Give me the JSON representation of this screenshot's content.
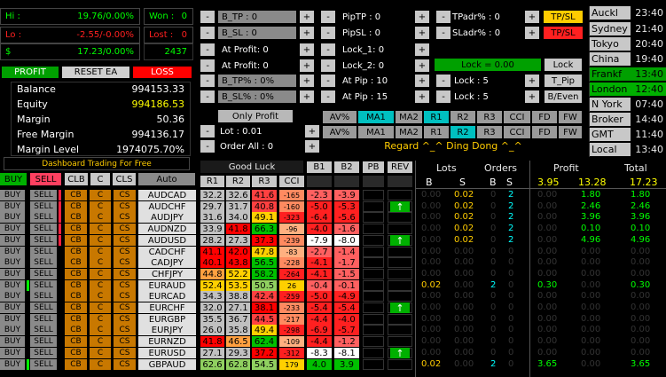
{
  "stats": {
    "hi_label": "Hi :",
    "hi_value": "19.76/0.00%",
    "lo_label": "Lo :",
    "lo_value": "-2.55/-0.00%",
    "usd_label": "$",
    "usd_value": "17.23/0.00%",
    "won_label": "Won :",
    "won_value": "0",
    "lost_label": "Lost :",
    "lost_value": "0",
    "count_value": "2437"
  },
  "controls": {
    "profit": "PROFIT",
    "reset": "RESET EA",
    "loss": "LOSS"
  },
  "account": [
    {
      "label": "Balance",
      "value": "994153.33"
    },
    {
      "label": "Equity",
      "value": "994186.53"
    },
    {
      "label": "Margin",
      "value": "50.36"
    },
    {
      "label": "Free Margin",
      "value": "994136.17"
    },
    {
      "label": "Margin Level",
      "value": "1974075.70%"
    }
  ],
  "dashboard_title": "Dashboard Trading For Free",
  "action_row": {
    "buy": "BUY",
    "sell": "SELL",
    "clb": "CLB",
    "c": "C",
    "cls": "CLS",
    "auto": "Auto"
  },
  "settings_col1": [
    "B_TP : 0",
    "B_SL : 0",
    "At Profit: 0",
    "At Profit: 0",
    "B_TP% : 0%",
    "B_SL% : 0%"
  ],
  "settings_col2": [
    "PipTP : 0",
    "PipSL : 0",
    "Lock_1: 0",
    "Lock_2: 0",
    "At Pip : 10",
    "At Pip : 15"
  ],
  "minus": "-",
  "plus": "+",
  "tpadr": "TPadr% : 0",
  "sladr": "SLadr% : 0",
  "tpsl": "TP/SL",
  "lock_value": "Lock = 0.00",
  "lock_btn": "Lock",
  "lock5a": "Lock : 5",
  "lock5b": "Lock : 5",
  "t_pip": "T_Pip",
  "b_even": "B/Even",
  "only_profit": "Only Profit",
  "lot": "Lot : 0.01",
  "order_all": "Order All : 0",
  "ma_row1": [
    "AV%",
    "MA1",
    "MA2",
    "R1",
    "R2",
    "R3",
    "CCI",
    "FD",
    "FW"
  ],
  "ma_row2": [
    "AV%",
    "MA1",
    "MA2",
    "R1",
    "R2",
    "R3",
    "CCI",
    "FD",
    "FW"
  ],
  "regard": "Regard    ^_^ Ding Dong ^_^",
  "sessions": [
    {
      "name": "Auckl",
      "time": "23:40"
    },
    {
      "name": "Sydney",
      "time": "21:40"
    },
    {
      "name": "Tokyo",
      "time": "20:40"
    },
    {
      "name": "China",
      "time": "19:40"
    },
    {
      "name": "Frankf",
      "time": "13:40"
    },
    {
      "name": "London",
      "time": "12:40"
    },
    {
      "name": "N York",
      "time": "07:40"
    },
    {
      "name": "Broker",
      "time": "14:40"
    },
    {
      "name": "GMT",
      "time": "11:40"
    },
    {
      "name": "Local",
      "time": "13:40"
    }
  ],
  "table_headers": {
    "good_luck": "Good Luck",
    "b1": "B1",
    "b2": "B2",
    "pb": "PB",
    "rev": "REV",
    "r1": "R1",
    "r2": "R2",
    "r3": "R3",
    "cci": "CCI",
    "lots": "Lots",
    "orders": "Orders",
    "profit": "Profit",
    "total": "Total",
    "b": "B",
    "s": "S"
  },
  "totals": {
    "profit_sum": "3.95",
    "profit_b": "13.28",
    "total": "17.23"
  },
  "row_buttons": {
    "buy": "BUY",
    "sell": "SELL",
    "cb": "CB",
    "cs": "CS",
    "c": "C"
  },
  "rows": [
    {
      "pair": "AUDCAD",
      "r1": "32.2",
      "r2": "32.6",
      "r3": "41.6",
      "cci": "-165",
      "b1": "-2.3",
      "b2": "-3.9",
      "arrow": false,
      "lb": "0.00",
      "ls": "0.02",
      "ob": "0",
      "os": "2",
      "pb": "0.00",
      "ps": "1.80",
      "tot": "1.80"
    },
    {
      "pair": "AUDCHF",
      "r1": "29.7",
      "r2": "31.7",
      "r3": "40.8",
      "cci": "-160",
      "b1": "-5.0",
      "b2": "-5.3",
      "arrow": true,
      "lb": "0.00",
      "ls": "0.02",
      "ob": "0",
      "os": "2",
      "pb": "0.00",
      "ps": "2.46",
      "tot": "2.46"
    },
    {
      "pair": "AUDJPY",
      "r1": "31.6",
      "r2": "34.0",
      "r3": "49.1",
      "cci": "-323",
      "b1": "-6.4",
      "b2": "-5.6",
      "arrow": false,
      "lb": "0.00",
      "ls": "0.02",
      "ob": "0",
      "os": "2",
      "pb": "0.00",
      "ps": "3.96",
      "tot": "3.96"
    },
    {
      "pair": "AUDNZD",
      "r1": "33.9",
      "r2": "41.8",
      "r3": "66.3",
      "cci": "-96",
      "b1": "-4.0",
      "b2": "-1.6",
      "arrow": false,
      "lb": "0.00",
      "ls": "0.02",
      "ob": "0",
      "os": "2",
      "pb": "0.00",
      "ps": "0.10",
      "tot": "0.10"
    },
    {
      "pair": "AUDUSD",
      "r1": "28.2",
      "r2": "27.3",
      "r3": "37.3",
      "cci": "-239",
      "b1": "-7.9",
      "b2": "-8.0",
      "arrow": true,
      "lb": "0.00",
      "ls": "0.02",
      "ob": "0",
      "os": "2",
      "pb": "0.00",
      "ps": "4.96",
      "tot": "4.96"
    },
    {
      "pair": "CADCHF",
      "r1": "41.1",
      "r2": "42.0",
      "r3": "47.8",
      "cci": "-83",
      "b1": "-2.7",
      "b2": "-1.4",
      "arrow": false,
      "lb": "0.00",
      "ls": "0.00",
      "ob": "0",
      "os": "0",
      "pb": "0.00",
      "ps": "0.00",
      "tot": "0.00"
    },
    {
      "pair": "CADJPY",
      "r1": "40.1",
      "r2": "43.8",
      "r3": "56.5",
      "cci": "-228",
      "b1": "-4.1",
      "b2": "-1.7",
      "arrow": false,
      "lb": "0.00",
      "ls": "0.00",
      "ob": "0",
      "os": "0",
      "pb": "0.00",
      "ps": "0.00",
      "tot": "0.00"
    },
    {
      "pair": "CHFJPY",
      "r1": "44.8",
      "r2": "52.2",
      "r3": "58.2",
      "cci": "-264",
      "b1": "-4.1",
      "b2": "-1.5",
      "arrow": false,
      "lb": "0.00",
      "ls": "0.00",
      "ob": "0",
      "os": "0",
      "pb": "0.00",
      "ps": "0.00",
      "tot": "0.00"
    },
    {
      "pair": "EURAUD",
      "r1": "52.4",
      "r2": "53.5",
      "r3": "50.5",
      "cci": "26",
      "b1": "-0.4",
      "b2": "-0.1",
      "arrow": false,
      "lb": "0.02",
      "ls": "0.00",
      "ob": "2",
      "os": "0",
      "pb": "0.30",
      "ps": "0.00",
      "tot": "0.30"
    },
    {
      "pair": "EURCAD",
      "r1": "34.3",
      "r2": "38.8",
      "r3": "42.4",
      "cci": "-259",
      "b1": "-5.0",
      "b2": "-4.9",
      "arrow": false,
      "lb": "0.00",
      "ls": "0.00",
      "ob": "0",
      "os": "0",
      "pb": "0.00",
      "ps": "0.00",
      "tot": "0.00"
    },
    {
      "pair": "EURCHF",
      "r1": "32.0",
      "r2": "27.1",
      "r3": "38.1",
      "cci": "-233",
      "b1": "-5.4",
      "b2": "-5.4",
      "arrow": true,
      "lb": "0.00",
      "ls": "0.00",
      "ob": "0",
      "os": "0",
      "pb": "0.00",
      "ps": "0.00",
      "tot": "0.00"
    },
    {
      "pair": "EURGBP",
      "r1": "35.5",
      "r2": "36.7",
      "r3": "44.5",
      "cci": "-217",
      "b1": "-4.4",
      "b2": "-4.0",
      "arrow": false,
      "lb": "0.00",
      "ls": "0.00",
      "ob": "0",
      "os": "0",
      "pb": "0.00",
      "ps": "0.00",
      "tot": "0.00"
    },
    {
      "pair": "EURJPY",
      "r1": "26.0",
      "r2": "35.8",
      "r3": "49.4",
      "cci": "-298",
      "b1": "-6.9",
      "b2": "-5.7",
      "arrow": false,
      "lb": "0.00",
      "ls": "0.00",
      "ob": "0",
      "os": "0",
      "pb": "0.00",
      "ps": "0.00",
      "tot": "0.00"
    },
    {
      "pair": "EURNZD",
      "r1": "41.8",
      "r2": "46.5",
      "r3": "62.4",
      "cci": "-109",
      "b1": "-4.4",
      "b2": "-1.2",
      "arrow": false,
      "lb": "0.00",
      "ls": "0.00",
      "ob": "0",
      "os": "0",
      "pb": "0.00",
      "ps": "0.00",
      "tot": "0.00"
    },
    {
      "pair": "EURUSD",
      "r1": "27.1",
      "r2": "29.3",
      "r3": "37.2",
      "cci": "-312",
      "b1": "-8.3",
      "b2": "-8.1",
      "arrow": true,
      "lb": "0.00",
      "ls": "0.00",
      "ob": "0",
      "os": "0",
      "pb": "0.00",
      "ps": "0.00",
      "tot": "0.00"
    },
    {
      "pair": "GBPAUD",
      "r1": "62.6",
      "r2": "62.8",
      "r3": "54.5",
      "cci": "179",
      "b1": "4.0",
      "b2": "3.9",
      "arrow": false,
      "lb": "0.02",
      "ls": "0.00",
      "ob": "2",
      "os": "0",
      "pb": "3.65",
      "ps": "0.00",
      "tot": "3.65"
    }
  ],
  "colors": {
    "red": "#ff0000",
    "green": "#00c000",
    "yellow": "#ffff00",
    "cyan": "#00ffff",
    "orange": "#c87800",
    "lime": "#00ff00"
  }
}
